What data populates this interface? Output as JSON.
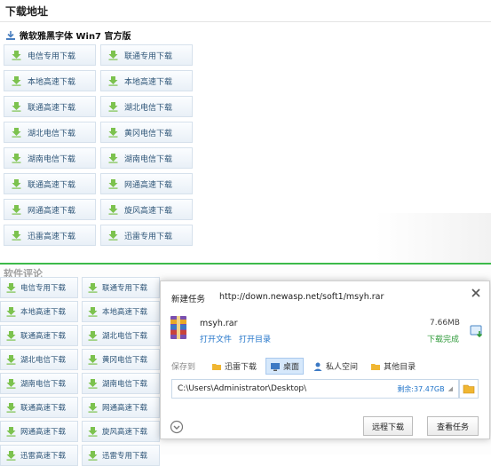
{
  "section": {
    "title": "下载地址",
    "subtitle": "微软雅黑字体 Win7 官方版"
  },
  "top_links": [
    "电信专用下载",
    "联通专用下载",
    "本地高速下载",
    "本地高速下载",
    "联通高速下载",
    "湖北电信下载",
    "湖北电信下载",
    "黄冈电信下载",
    "湖南电信下载",
    "湖南电信下载",
    "联通高速下载",
    "网通高速下载",
    "网通高速下载",
    "旋风高速下载",
    "迅雷高速下载",
    "迅雷专用下载"
  ],
  "bottom_title": "软件评论",
  "bottom_links": [
    "电信专用下载",
    "联通专用下载",
    "本地高速下载",
    "本地高速下载",
    "联通高速下载",
    "湖北电信下载",
    "湖北电信下载",
    "黄冈电信下载",
    "湖南电信下载",
    "湖南电信下载",
    "联通高速下载",
    "网通高速下载",
    "网通高速下载",
    "旋风高速下载",
    "迅雷高速下载",
    "迅雷专用下载"
  ],
  "dialog": {
    "title": "新建任务",
    "url": "http://down.newasp.net/soft1/msyh.rar",
    "file_name": "msyh.rar",
    "open_file": "打开文件",
    "open_dir": "打开目录",
    "size": "7.66MB",
    "status": "下载完成",
    "save_to_label": "保存到",
    "locations": [
      {
        "label": "迅雷下载",
        "icon": "folder-icon"
      },
      {
        "label": "桌面",
        "icon": "desktop-icon",
        "selected": true
      },
      {
        "label": "私人空间",
        "icon": "user-space-icon"
      },
      {
        "label": "其他目录",
        "icon": "folder-icon"
      }
    ],
    "path": "C:\\Users\\Administrator\\Desktop\\",
    "free_space": "剩余:37.47GB",
    "remote_button": "远程下载",
    "view_button": "查看任务"
  },
  "colors": {
    "link_text": "#2f5678",
    "accent_blue": "#1f73c9",
    "success_green": "#2f9a3a",
    "separator_green": "#3cba4a"
  }
}
